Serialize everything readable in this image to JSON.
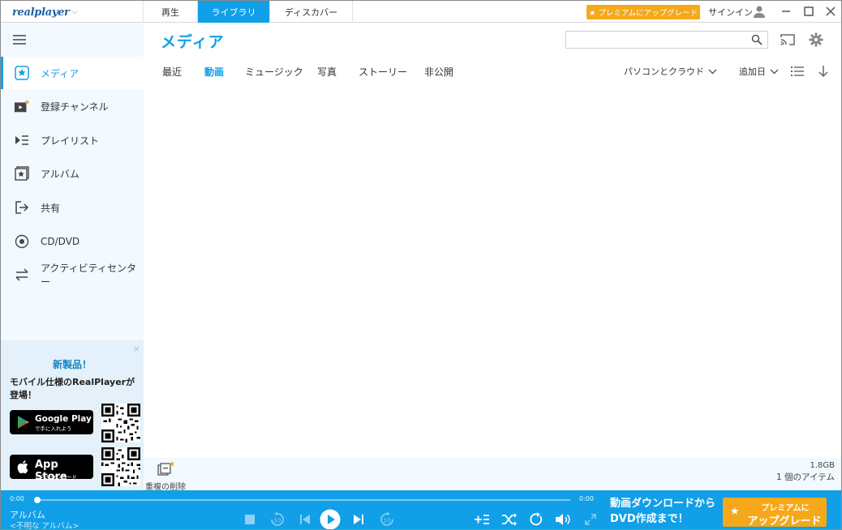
{
  "app": {
    "logo": "realplayer"
  },
  "top_tabs": [
    {
      "label": "再生"
    },
    {
      "label": "ライブラリ"
    },
    {
      "label": "ディスカバー"
    }
  ],
  "header": {
    "premium_button": "★ プレミアムにアップグレード",
    "signin": "サインイン"
  },
  "sidebar": {
    "items": [
      {
        "label": "メディア",
        "icon": "star-icon"
      },
      {
        "label": "登録チャンネル",
        "icon": "channel-icon"
      },
      {
        "label": "プレイリスト",
        "icon": "playlist-icon"
      },
      {
        "label": "アルバム",
        "icon": "album-icon"
      },
      {
        "label": "共有",
        "icon": "share-icon"
      },
      {
        "label": "CD/DVD",
        "icon": "disc-icon"
      },
      {
        "label": "アクティビティセンター",
        "icon": "activity-icon"
      }
    ],
    "promo": {
      "close": "×",
      "title": "新製品！",
      "desc": "モバイル仕様のRealPlayerが登場！",
      "google": {
        "line1": "Google Play",
        "line2": "で手に入れよう"
      },
      "apple": {
        "line1": "App Store",
        "line2": "からダウンロード"
      }
    }
  },
  "main": {
    "title": "メディア",
    "search_placeholder": "",
    "subtabs": [
      {
        "label": "最近"
      },
      {
        "label": "動画"
      },
      {
        "label": "ミュージック"
      },
      {
        "label": "写真"
      },
      {
        "label": "ストーリー"
      },
      {
        "label": "非公開"
      }
    ],
    "source_dropdown": "パソコンとクラウド",
    "sort_dropdown": "追加日"
  },
  "status": {
    "dup_label": "重複の削除",
    "size": "1.8GB",
    "count": "1 個のアイテム"
  },
  "player": {
    "time_left": "0:00",
    "time_right": "0:00",
    "album": "アルバム",
    "album_sub": "<不明な アルバム>",
    "dvd_line1": "動画ダウンロードから",
    "dvd_line2": "DVD作成まで！",
    "premium_line1": "プレミアムに",
    "premium_line2": "アップグレード"
  },
  "colors": {
    "accent": "#119fe8",
    "premium": "#f5a819",
    "sidebar_bg": "#f2f9ff"
  }
}
